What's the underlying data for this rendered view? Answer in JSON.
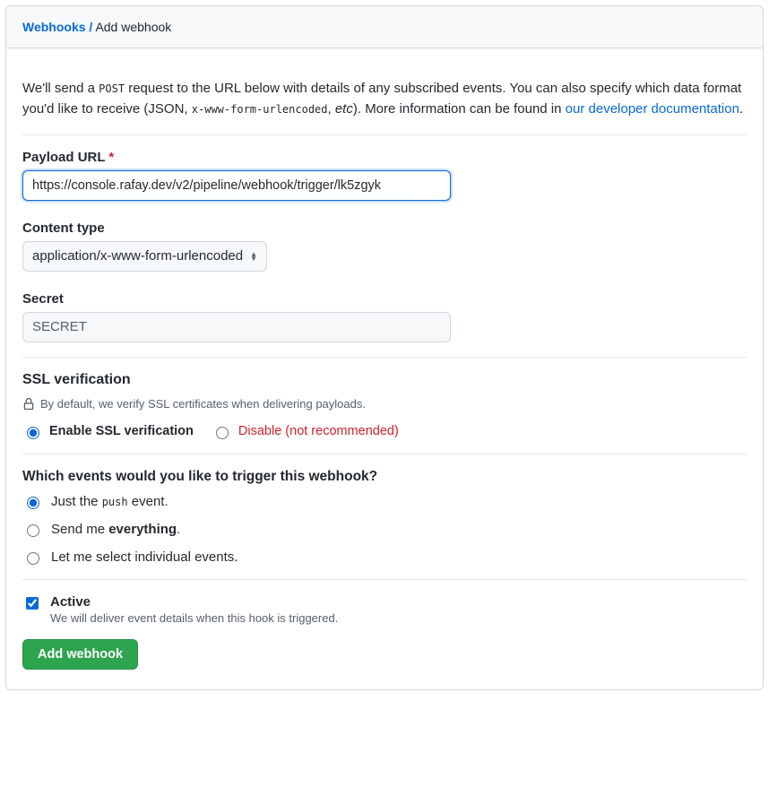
{
  "breadcrumb": {
    "root": "Webhooks",
    "sep": "/",
    "current": "Add webhook"
  },
  "intro": {
    "t1": "We'll send a ",
    "post": "POST",
    "t2": " request to the URL below with details of any subscribed events. You can also specify which data format you'd like to receive (JSON, ",
    "form": "x-www-form-urlencoded",
    "t3": ", ",
    "etc": "etc",
    "t4": "). More information can be found in ",
    "link": "our developer documentation",
    "t5": "."
  },
  "payload": {
    "label": "Payload URL",
    "value": "https://console.rafay.dev/v2/pipeline/webhook/trigger/lk5zgyk"
  },
  "content_type": {
    "label": "Content type",
    "value": "application/x-www-form-urlencoded"
  },
  "secret": {
    "label": "Secret",
    "value": "SECRET"
  },
  "ssl": {
    "heading": "SSL verification",
    "note": "By default, we verify SSL certificates when delivering payloads.",
    "enable": "Enable SSL verification",
    "disable": "Disable",
    "disable_sub": "(not recommended)"
  },
  "events": {
    "heading": "Which events would you like to trigger this webhook?",
    "opt1_a": "Just the ",
    "opt1_mono": "push",
    "opt1_b": " event.",
    "opt2_a": "Send me ",
    "opt2_strong": "everything",
    "opt2_b": ".",
    "opt3": "Let me select individual events."
  },
  "active": {
    "label": "Active",
    "sub": "We will deliver event details when this hook is triggered."
  },
  "submit": {
    "label": "Add webhook"
  }
}
